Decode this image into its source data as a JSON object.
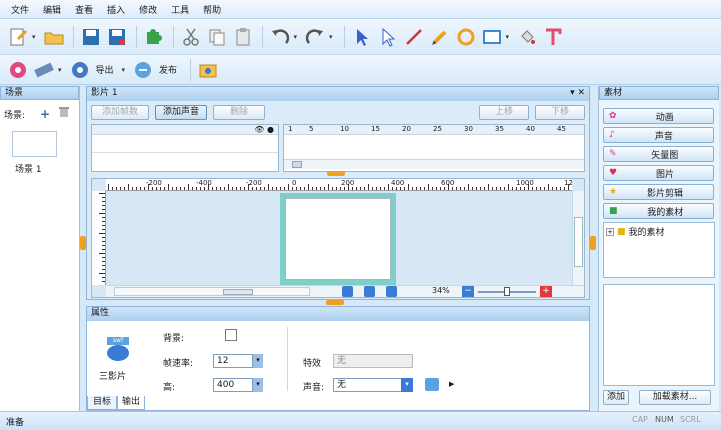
{
  "menu": [
    "文件",
    "编辑",
    "查看",
    "插入",
    "修改",
    "工具",
    "帮助"
  ],
  "toolbar2": {
    "export_label": "导出",
    "publish_label": "发布"
  },
  "scenes_panel": {
    "title": "场景",
    "scenes_label": "场景:",
    "scene_name": "场景 1"
  },
  "center": {
    "tab_label": "影片 1",
    "add_frame": "添加帧数",
    "add_sound": "添加声音",
    "delete": "删除",
    "up": "上移",
    "down": "下移",
    "timeline_numbers": [
      "1",
      "5",
      "10",
      "15",
      "20",
      "25",
      "30",
      "35",
      "40",
      "45"
    ],
    "ruler_numbers": [
      "-200",
      "-400",
      "-200",
      "0",
      "200",
      "400",
      "600",
      "1000",
      "12"
    ],
    "zoom": "34%"
  },
  "assets": {
    "title": "素材",
    "items": [
      "动画",
      "声音",
      "矢量图",
      "图片",
      "影片剪辑",
      "我的素材"
    ],
    "tree_folder": "我的素材",
    "add": "添加",
    "load": "加载素材..."
  },
  "properties": {
    "title": "属性",
    "object_label": "三影片",
    "badge": "swf",
    "background_label": "背景:",
    "frame_rate_label": "帧速率:",
    "frame_rate_value": "12",
    "height_label": "高:",
    "height_value": "400",
    "effect_label": "特效",
    "effect_value": "无",
    "sound_label": "声音:",
    "sound_value": "无",
    "tab_file": "目标",
    "tab_output": "输出"
  },
  "status": {
    "ready": "准备",
    "caps": "CAP",
    "num": "NUM",
    "scrl": "SCRL"
  },
  "colors": {
    "accent": "#8fb6da",
    "canvas_border": "#7fcfc9",
    "highlight": "#cbe3fa"
  }
}
